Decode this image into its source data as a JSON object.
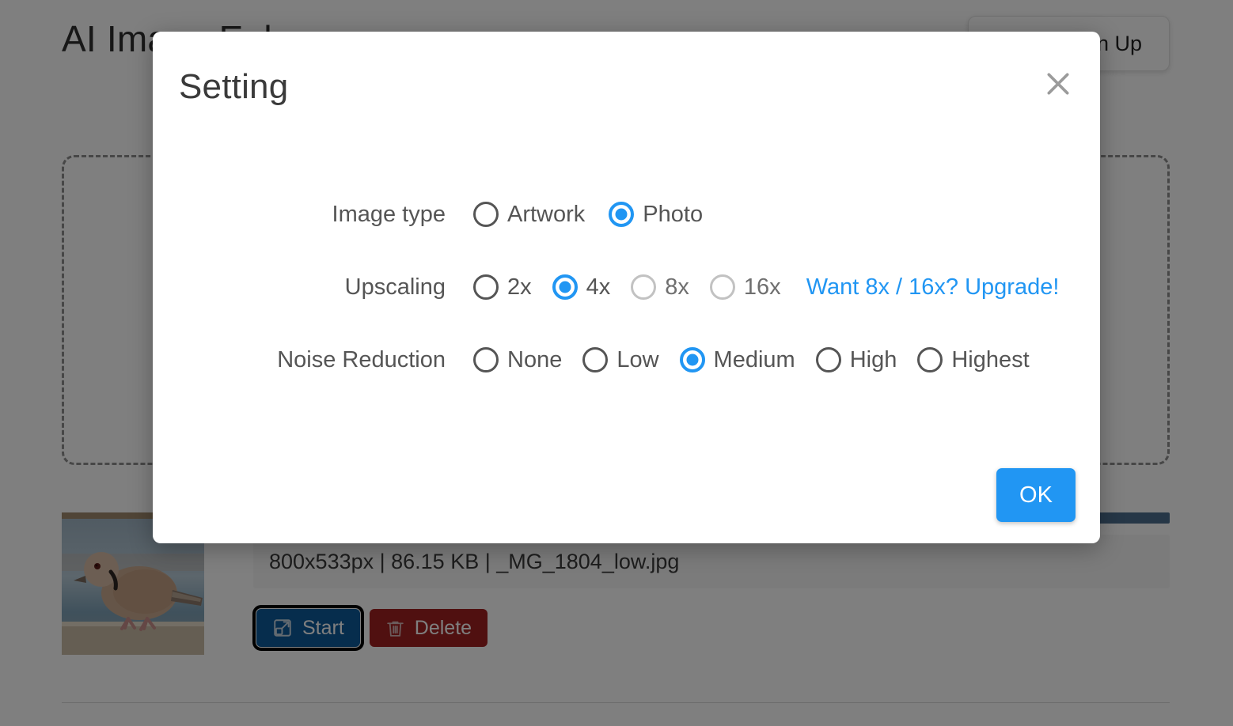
{
  "background": {
    "app_title": "AI Image Enlarger",
    "signup_button": "Sign Up",
    "dropzone": "",
    "file": {
      "info": "800x533px | 86.15 KB | _MG_1804_low.jpg",
      "start_label": "Start",
      "delete_label": "Delete",
      "start_icon": "expand-arrow-icon",
      "delete_icon": "trash-icon",
      "thumbnail_alt": "collared-dove-photo"
    }
  },
  "dialog": {
    "title": "Setting",
    "close_icon": "close-icon",
    "ok_label": "OK",
    "rows": [
      {
        "label": "Image type",
        "options": [
          {
            "label": "Artwork",
            "selected": false,
            "disabled": false
          },
          {
            "label": "Photo",
            "selected": true,
            "disabled": false
          }
        ]
      },
      {
        "label": "Upscaling",
        "options": [
          {
            "label": "2x",
            "selected": false,
            "disabled": false
          },
          {
            "label": "4x",
            "selected": true,
            "disabled": false
          },
          {
            "label": "8x",
            "selected": false,
            "disabled": true
          },
          {
            "label": "16x",
            "selected": false,
            "disabled": true
          }
        ],
        "link": "Want 8x / 16x? Upgrade!"
      },
      {
        "label": "Noise Reduction",
        "options": [
          {
            "label": "None",
            "selected": false,
            "disabled": false
          },
          {
            "label": "Low",
            "selected": false,
            "disabled": false
          },
          {
            "label": "Medium",
            "selected": true,
            "disabled": false
          },
          {
            "label": "High",
            "selected": false,
            "disabled": false
          },
          {
            "label": "Highest",
            "selected": false,
            "disabled": false
          }
        ]
      }
    ]
  },
  "colors": {
    "accent": "#2196f3",
    "start_button": "#0d5a9a",
    "delete_button": "#a02020",
    "label_text": "#555555",
    "disabled_radio": "#c2c2c2"
  }
}
